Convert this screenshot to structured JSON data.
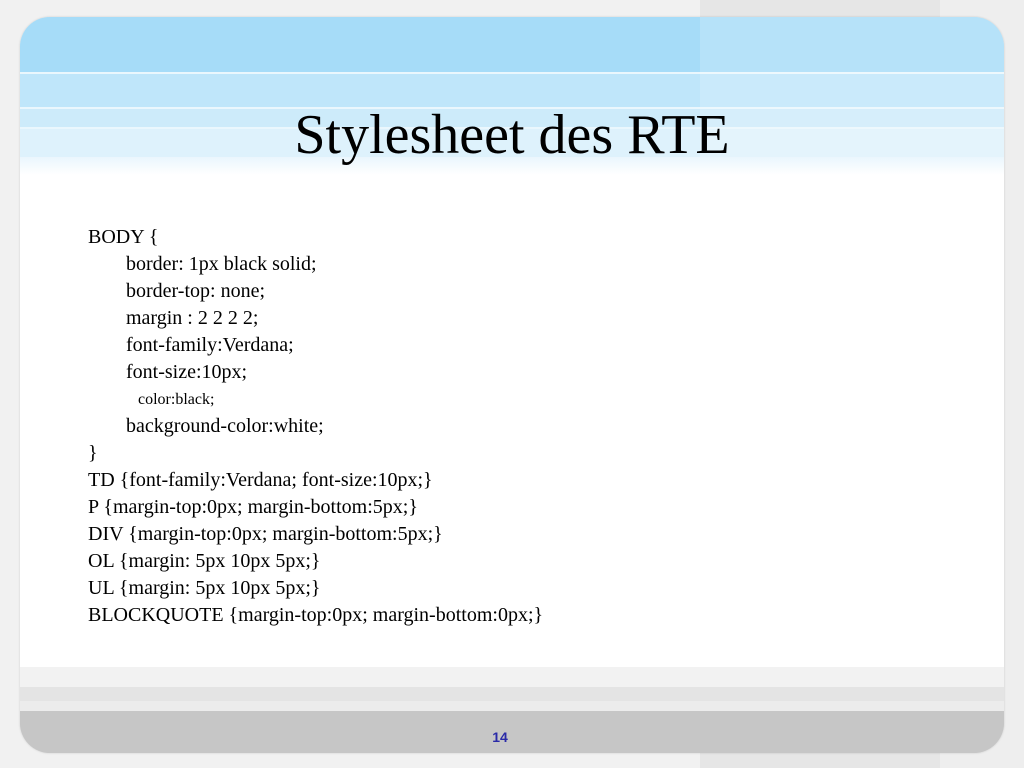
{
  "slide": {
    "title": "Stylesheet des RTE",
    "page_number": "14",
    "code_lines": [
      {
        "text": "BODY {",
        "indent": "none"
      },
      {
        "text": "border: 1px black solid;",
        "indent": "indent"
      },
      {
        "text": "border-top: none;",
        "indent": "indent"
      },
      {
        "text": "margin : 2 2 2 2;",
        "indent": "indent"
      },
      {
        "text": "font-family:Verdana;",
        "indent": "indent"
      },
      {
        "text": "font-size:10px;",
        "indent": "indent"
      },
      {
        "text": "color:black;",
        "indent": "small"
      },
      {
        "text": "background-color:white;",
        "indent": "indent"
      },
      {
        "text": "}",
        "indent": "none"
      },
      {
        "text": "TD {font-family:Verdana; font-size:10px;}",
        "indent": "none"
      },
      {
        "text": "P {margin-top:0px; margin-bottom:5px;}",
        "indent": "none"
      },
      {
        "text": "DIV {margin-top:0px; margin-bottom:5px;}",
        "indent": "none"
      },
      {
        "text": "OL {margin: 5px 10px 5px;}",
        "indent": "none"
      },
      {
        "text": "UL {margin: 5px 10px 5px;}",
        "indent": "none"
      },
      {
        "text": "BLOCKQUOTE {margin-top:0px; margin-bottom:0px;}",
        "indent": "none"
      }
    ]
  },
  "colors": {
    "header_blue": "#a6dcf8",
    "page_number": "#2a2aa8",
    "footer_gray": "#c6c6c6"
  }
}
